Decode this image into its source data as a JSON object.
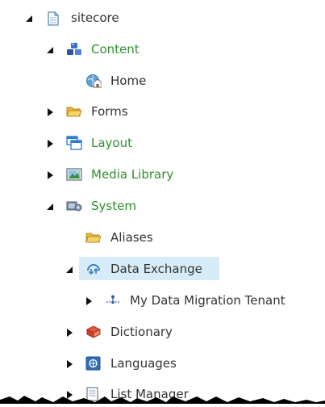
{
  "tree": {
    "items": [
      {
        "label": "sitecore",
        "icon": "document-icon",
        "expanded": true
      },
      {
        "label": "Content",
        "icon": "content-cubes-icon",
        "expanded": true
      },
      {
        "label": "Home",
        "icon": "home-globe-icon",
        "expanded": null
      },
      {
        "label": "Forms",
        "icon": "folder-icon",
        "expanded": false
      },
      {
        "label": "Layout",
        "icon": "layout-window-icon",
        "expanded": false
      },
      {
        "label": "Media Library",
        "icon": "image-icon",
        "expanded": false
      },
      {
        "label": "System",
        "icon": "system-gears-icon",
        "expanded": true
      },
      {
        "label": "Aliases",
        "icon": "folder-icon",
        "expanded": null
      },
      {
        "label": "Data Exchange",
        "icon": "data-exchange-icon",
        "expanded": true,
        "selected": true
      },
      {
        "label": "My Data Migration Tenant",
        "icon": "tenant-network-icon",
        "expanded": false
      },
      {
        "label": "Dictionary",
        "icon": "dictionary-book-icon",
        "expanded": false
      },
      {
        "label": "Languages",
        "icon": "languages-flag-icon",
        "expanded": false
      },
      {
        "label": "List Manager",
        "icon": "list-manager-icon",
        "expanded": false
      }
    ]
  },
  "colors": {
    "green_label": "#2f8f2f",
    "selected_background": "#d8ecf8",
    "toggle": "#111111"
  }
}
